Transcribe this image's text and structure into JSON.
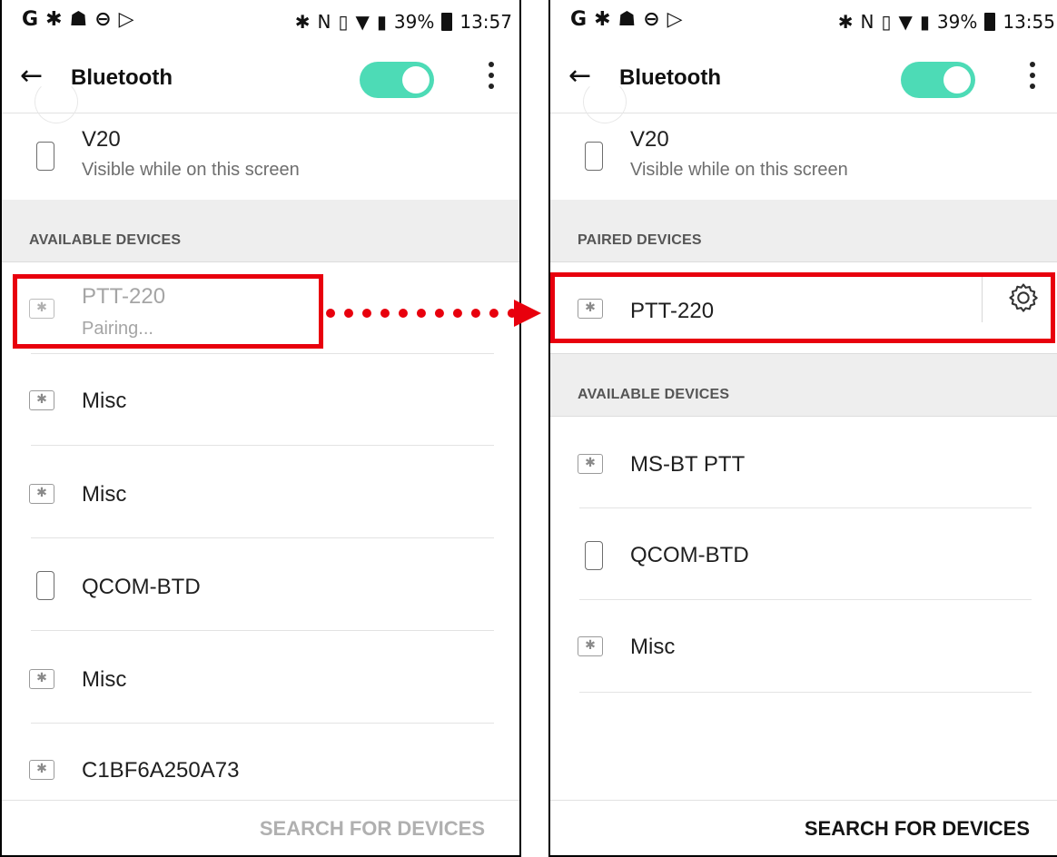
{
  "status_left": {
    "icons": [
      "G",
      "✱",
      "☗",
      "⊖",
      "▷"
    ]
  },
  "status_right_left": {
    "battery_pct": "39%",
    "time": "13:57"
  },
  "status_right_right": {
    "battery_pct": "39%",
    "time": "13:55"
  },
  "appbar": {
    "title": "Bluetooth",
    "back_glyph": "←",
    "toggle_on": true
  },
  "own_device": {
    "name": "V20",
    "subtitle": "Visible while on this screen"
  },
  "left": {
    "available_header": "AVAILABLE DEVICES",
    "pairing": {
      "name": "PTT-220",
      "status": "Pairing..."
    },
    "devices": [
      {
        "name": "Misc",
        "icon": "bluetooth-device-icon"
      },
      {
        "name": "Misc",
        "icon": "bluetooth-device-icon"
      },
      {
        "name": "QCOM-BTD",
        "icon": "phone-icon"
      },
      {
        "name": "Misc",
        "icon": "bluetooth-device-icon"
      },
      {
        "name": "C1BF6A250A73",
        "icon": "bluetooth-device-icon"
      }
    ],
    "search_label": "SEARCH FOR DEVICES"
  },
  "right": {
    "paired_header": "PAIRED DEVICES",
    "paired": {
      "name": "PTT-220"
    },
    "available_header": "AVAILABLE DEVICES",
    "devices": [
      {
        "name": "MS-BT PTT",
        "icon": "bluetooth-device-icon"
      },
      {
        "name": "QCOM-BTD",
        "icon": "phone-icon"
      },
      {
        "name": "Misc",
        "icon": "bluetooth-device-icon"
      }
    ],
    "search_label": "SEARCH FOR DEVICES"
  },
  "colors": {
    "toggle": "#4ddbb6",
    "highlight": "#e8000d",
    "section_bg": "#eeeeee"
  }
}
